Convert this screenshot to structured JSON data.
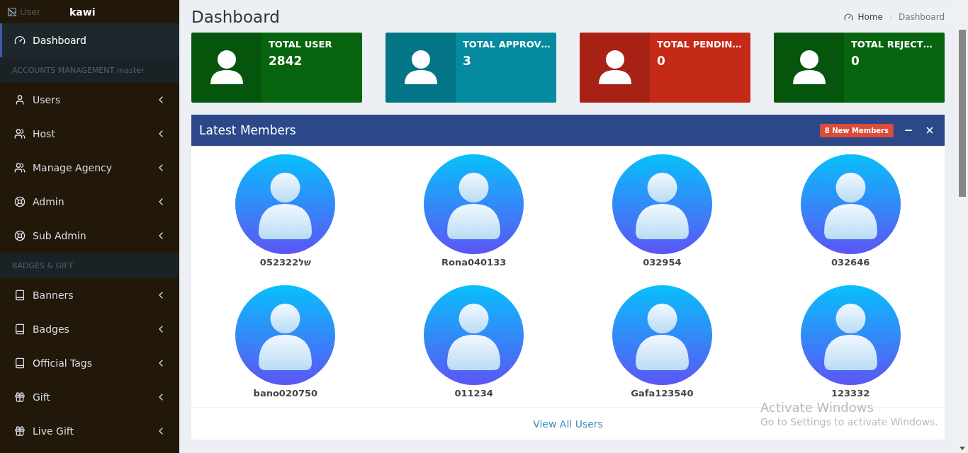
{
  "sidebar": {
    "user_image_alt": "User",
    "user_name": "kawi",
    "items": [
      {
        "kind": "link",
        "label": "Dashboard",
        "selected": true
      },
      {
        "kind": "header",
        "label": "ACCOUNTS MANAGEMENT master"
      },
      {
        "kind": "link",
        "label": "Users",
        "selected": false
      },
      {
        "kind": "link",
        "label": "Host",
        "selected": false
      },
      {
        "kind": "link",
        "label": "Manage Agency",
        "selected": false
      },
      {
        "kind": "link",
        "label": "Admin",
        "selected": false
      },
      {
        "kind": "link",
        "label": "Sub Admin",
        "selected": false
      },
      {
        "kind": "header",
        "label": "BADGES & GIFT"
      },
      {
        "kind": "link",
        "label": "Banners",
        "selected": false
      },
      {
        "kind": "link",
        "label": "Badges",
        "selected": false
      },
      {
        "kind": "link",
        "label": "Official Tags",
        "selected": false
      },
      {
        "kind": "link",
        "label": "Gift",
        "selected": false
      },
      {
        "kind": "link",
        "label": "Live Gift",
        "selected": false
      }
    ]
  },
  "page_title": "Dashboard",
  "breadcrumb": [
    "Home",
    "Dashboard"
  ],
  "stats": [
    {
      "label": "TOTAL USER",
      "value": "2842",
      "color": "#07650f"
    },
    {
      "label": "TOTAL APPROV…",
      "value": "3",
      "color": "#058a9f"
    },
    {
      "label": "TOTAL PENDIN…",
      "value": "0",
      "color": "#c52918"
    },
    {
      "label": "TOTAL REJECT…",
      "value": "0",
      "color": "#07650f"
    }
  ],
  "latest_members": {
    "title": "Latest Members",
    "badge": "8 New Members",
    "members": [
      "052322של",
      "Rona040133",
      "032954",
      "032646",
      "bano020750",
      "011234",
      "Gafa123540",
      "123332"
    ],
    "footer_link": "View All Users"
  },
  "os_notice": {
    "title": "Activate Windows",
    "subtitle": "Go to Settings to activate Windows."
  }
}
